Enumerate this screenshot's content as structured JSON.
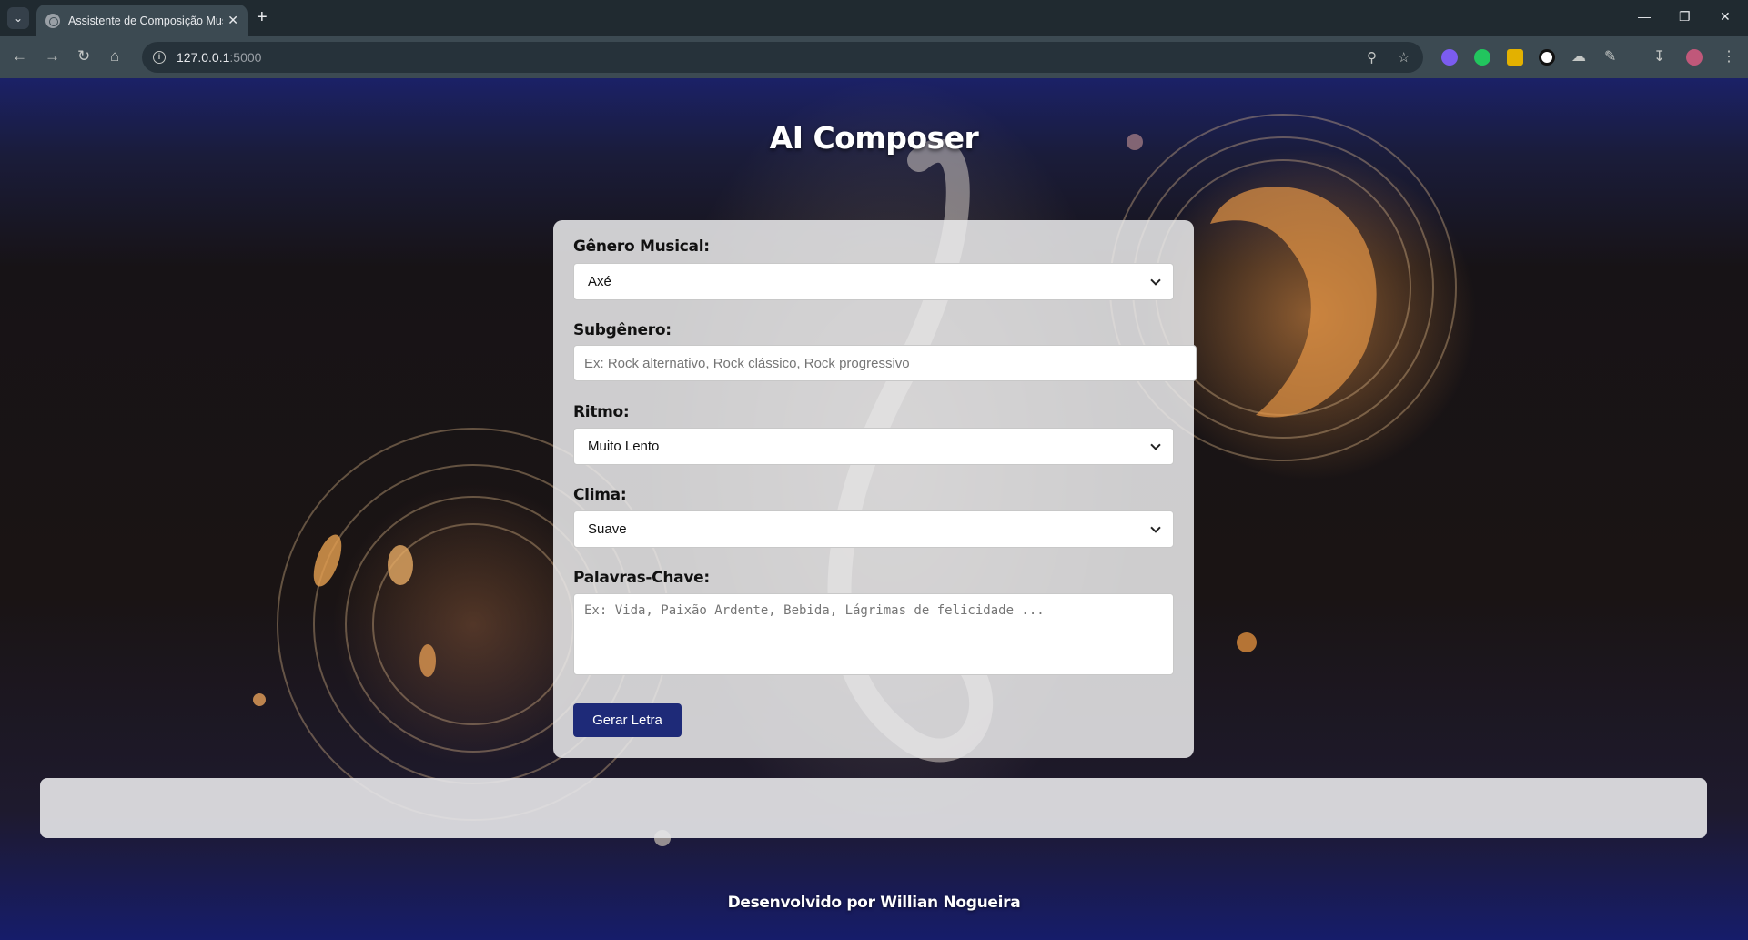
{
  "browser": {
    "tab_title": "Assistente de Composição Musical",
    "url_host": "127.0.0.1",
    "url_port": ":5000"
  },
  "page": {
    "title": "AI Composer",
    "footer": "Desenvolvido por Willian Nogueira"
  },
  "form": {
    "genre": {
      "label": "Gênero Musical:",
      "value": "Axé"
    },
    "subgenre": {
      "label": "Subgênero:",
      "placeholder": "Ex: Rock alternativo, Rock clássico, Rock progressivo"
    },
    "rhythm": {
      "label": "Ritmo:",
      "value": "Muito Lento"
    },
    "mood": {
      "label": "Clima:",
      "value": "Suave"
    },
    "keywords": {
      "label": "Palavras-Chave:",
      "placeholder": "Ex: Vida, Paixão Ardente, Bebida, Lágrimas de felicidade ..."
    },
    "submit_label": "Gerar Letra"
  },
  "colors": {
    "button": "#1e2a78",
    "header_gradient": "#1b2167"
  }
}
